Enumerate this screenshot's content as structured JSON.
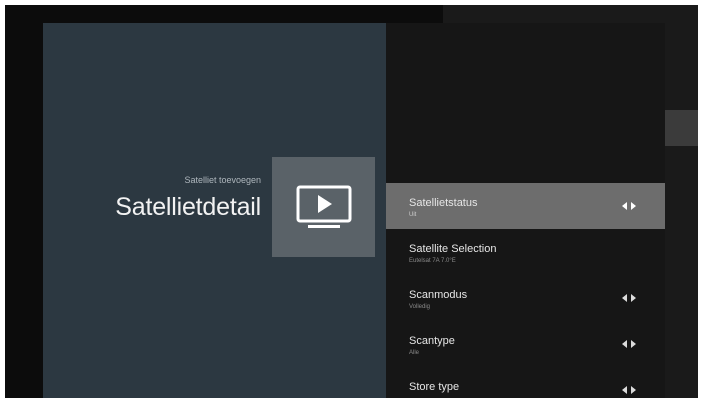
{
  "header": {
    "breadcrumb": "Satelliet toevoegen",
    "title": "Satellietdetail"
  },
  "tile": {
    "icon": "tv-play-icon"
  },
  "menu": {
    "items": [
      {
        "label": "Satellietstatus",
        "value": "Uit",
        "has_arrows": true,
        "selected": true
      },
      {
        "label": "Satellite Selection",
        "value": "Eutelsat 7A 7.0°E",
        "has_arrows": false,
        "selected": false
      },
      {
        "label": "Scanmodus",
        "value": "Volledig",
        "has_arrows": true,
        "selected": false
      },
      {
        "label": "Scantype",
        "value": "Alle",
        "has_arrows": true,
        "selected": false
      },
      {
        "label": "Store type",
        "value": "",
        "has_arrows": true,
        "selected": false
      }
    ]
  },
  "colors": {
    "left_panel": "#2c3841",
    "right_panel": "#161616",
    "selected_row": "#6d6d6d",
    "tile": "#5a6268"
  }
}
